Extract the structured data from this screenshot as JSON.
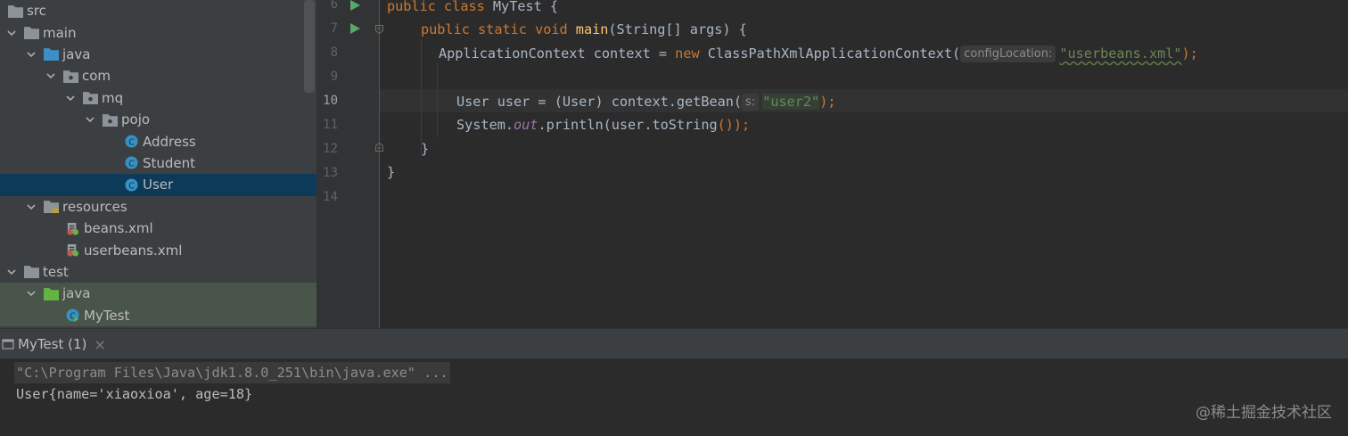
{
  "project_tree": {
    "items": [
      {
        "label": "src"
      },
      {
        "label": "main"
      },
      {
        "label": "java"
      },
      {
        "label": "com"
      },
      {
        "label": "mq"
      },
      {
        "label": "pojo"
      },
      {
        "label": "Address"
      },
      {
        "label": "Student"
      },
      {
        "label": "User"
      },
      {
        "label": "resources"
      },
      {
        "label": "beans.xml"
      },
      {
        "label": "userbeans.xml"
      },
      {
        "label": "test"
      },
      {
        "label": "java"
      },
      {
        "label": "MyTest"
      }
    ]
  },
  "editor": {
    "line_numbers": [
      "6",
      "7",
      "8",
      "9",
      "10",
      "11",
      "12",
      "13",
      "14"
    ],
    "line6": {
      "kw1": "public",
      "kw2": "class",
      "name": "MyTest",
      "brace": " {"
    },
    "line7": {
      "kw1": "public",
      "kw2": "static",
      "kw3": "void",
      "fn": "main",
      "rest": "(String[] args) {"
    },
    "line8": {
      "pre": "ApplicationContext context = ",
      "kw": "new",
      "mid": " ClassPathXmlApplicationContext(",
      "hint": "configLocation:",
      "str": "\"userbeans.xml\"",
      "end": ");"
    },
    "line10": {
      "pre": "User user = (User) context.getBean(",
      "hint": "s:",
      "str": "\"user2\"",
      "end": ");"
    },
    "line11": {
      "pre": "System.",
      "field": "out",
      "mid": ".println(user.",
      "method": "toString",
      "end": "());"
    },
    "line12": "}",
    "line13": "}"
  },
  "run_panel": {
    "tab_label": "MyTest (1)",
    "close_symbol": "×",
    "command": "\"C:\\Program Files\\Java\\jdk1.8.0_251\\bin\\java.exe\" ...",
    "output": "User{name='xiaoxioa', age=18}"
  },
  "watermark": "@稀土掘金技术社区",
  "colors": {
    "keyword": "#cc7832",
    "function": "#ffc66d",
    "string": "#6a8759",
    "text": "#a9b7c6",
    "selection": "#0d3a58"
  }
}
